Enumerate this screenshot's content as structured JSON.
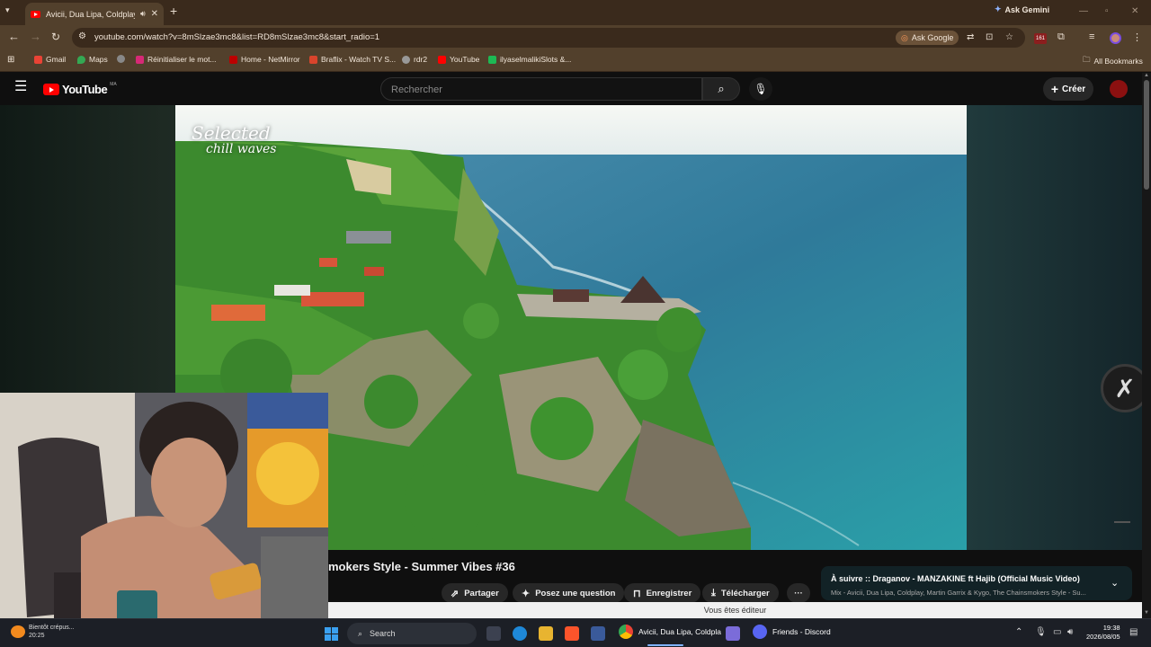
{
  "browser": {
    "tab_title": "Avicii, Dua Lipa, Coldplay, M",
    "ask_gemini": "Ask Gemini",
    "url": "youtube.com/watch?v=8mSlzae3mc8&list=RD8mSlzae3mc8&start_radio=1",
    "ask_google": "Ask Google",
    "extension_badge": "161",
    "bookmarks": [
      "Gmail",
      "Maps",
      "Réinitialiser le mot...",
      "Home - NetMirror",
      "Braflix - Watch TV S...",
      "rdr2",
      "YouTube",
      "ilyaselmalikiSlots &..."
    ],
    "all_bookmarks": "All Bookmarks"
  },
  "youtube": {
    "logo_text": "YouTube",
    "logo_region": "MA",
    "search_placeholder": "Rechercher",
    "create_label": "Créer"
  },
  "video": {
    "watermark_line1": "Selected",
    "watermark_line2": "chill waves",
    "title": "mokers Style - Summer Vibes #36",
    "actions": {
      "share": "Partager",
      "ask": "Posez une question",
      "save": "Enregistrer",
      "download": "Télécharger"
    },
    "up_next_title": "À suivre :: Draganov - MANZAKINE ft Hajib (Official Music Video)",
    "up_next_subtitle": "Mix - Avicii, Dua Lipa, Coldplay, Martin Garrix & Kygo, The Chainsmokers Style - Su...",
    "editor_banner": "Vous êtes éditeur"
  },
  "taskbar": {
    "weather_line1": "Bientôt crépus...",
    "weather_line2": "20:25",
    "search_label": "Search",
    "chrome_app": "Avicii, Dua Lipa, Coldpla",
    "discord_app": "Friends - Discord",
    "time": "19:38",
    "date": "2026/08/05"
  }
}
